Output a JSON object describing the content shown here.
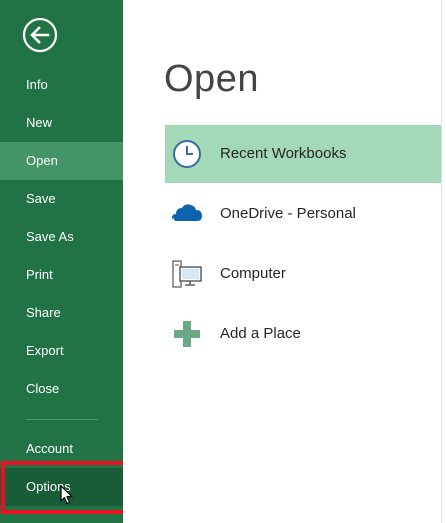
{
  "backstage": {
    "back_icon": "back-arrow-icon",
    "nav": [
      {
        "label": "Info"
      },
      {
        "label": "New"
      },
      {
        "label": "Open"
      },
      {
        "label": "Save"
      },
      {
        "label": "Save As"
      },
      {
        "label": "Print"
      },
      {
        "label": "Share"
      },
      {
        "label": "Export"
      },
      {
        "label": "Close"
      },
      {
        "label": "Account"
      },
      {
        "label": "Options"
      }
    ],
    "selected": "Open",
    "hovered": "Options",
    "colors": {
      "sidebar": "#217346",
      "selected_nav": "#439467",
      "hover_nav": "#195d38",
      "highlight_box": "#e81123",
      "selected_place": "#a3d8b9"
    }
  },
  "main": {
    "title": "Open",
    "places": [
      {
        "label": "Recent Workbooks",
        "icon": "clock-icon"
      },
      {
        "label": "OneDrive - Personal",
        "icon": "onedrive-cloud-icon"
      },
      {
        "label": "Computer",
        "icon": "computer-icon"
      },
      {
        "label": "Add a Place",
        "icon": "plus-icon"
      }
    ]
  }
}
